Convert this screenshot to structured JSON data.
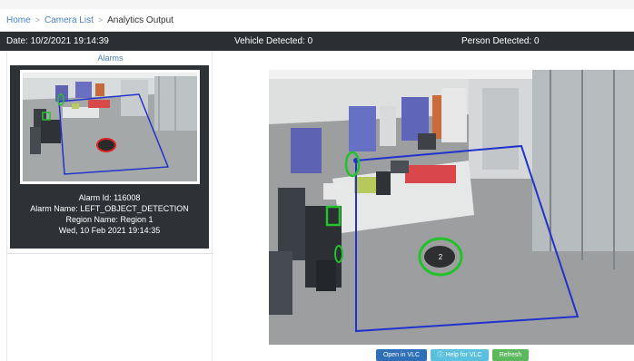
{
  "breadcrumb": {
    "home": "Home",
    "sep1": ">",
    "camera_list": "Camera List",
    "sep2": ">",
    "current": "Analytics Output"
  },
  "status": {
    "date": "Date: 10/2/2021 19:14:39",
    "vehicle": "Vehicle Detected: 0",
    "person": "Person Detected: 0"
  },
  "alarms": {
    "title": "Alarms",
    "items": [
      {
        "alarm_id": "Alarm Id: 116008",
        "alarm_name": "Alarm Name: LEFT_OBJECT_DETECTION",
        "region_name": "Region Name: Region 1",
        "timestamp": "Wed, 10 Feb 2021 19:14:35"
      }
    ]
  },
  "video": {
    "overlay_text": "2"
  },
  "buttons": {
    "open_vlc": "Open in VLC",
    "help_vlc": "Help for VLC",
    "refresh": "Refresh"
  },
  "colors": {
    "status_bar": "#2b2f33",
    "link": "#4a80c8",
    "region_outline": "#2233cc",
    "detection_ring": "#22c22a",
    "alarm_ring": "#dd2222",
    "btn_primary": "#2f6fb8",
    "btn_info": "#5bc0de",
    "btn_success": "#5cb85c"
  },
  "icons": {
    "help": "info-circle-icon"
  }
}
